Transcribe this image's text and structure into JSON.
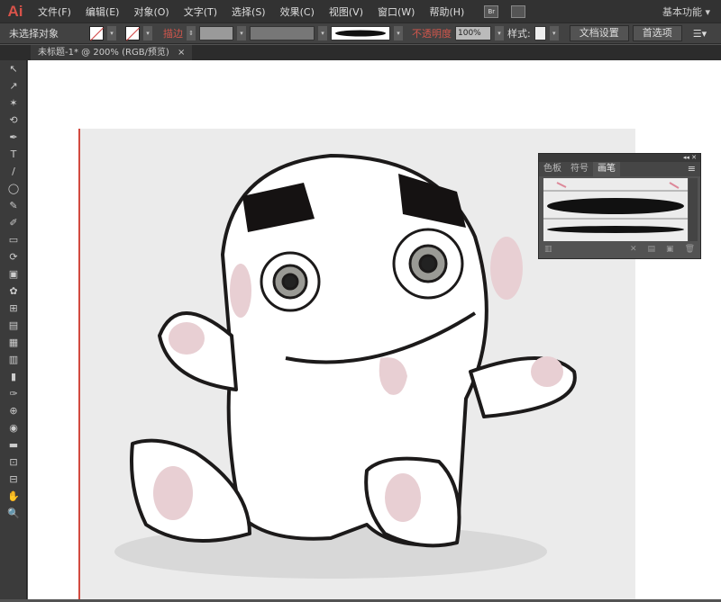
{
  "app": {
    "logo": "Ai",
    "workspace": "基本功能 ▾"
  },
  "menu": [
    "文件(F)",
    "编辑(E)",
    "对象(O)",
    "文字(T)",
    "选择(S)",
    "效果(C)",
    "视图(V)",
    "窗口(W)",
    "帮助(H)"
  ],
  "bridge_label": "Br",
  "control": {
    "selection": "未选择对象",
    "stroke_label": "描边",
    "opacity_label": "不透明度",
    "opacity_value": "100%",
    "style_label": "样式:",
    "doc_setup": "文档设置",
    "preferences": "首选项"
  },
  "document_tab": {
    "title": "未标题-1* @ 200% (RGB/预览)",
    "close": "×"
  },
  "tools": [
    "↖",
    "↗",
    "✶",
    "⟲",
    "✒",
    "T",
    "/",
    "◯",
    "✎",
    "✐",
    "▭",
    "⟳",
    "▣",
    "✿",
    "⊞",
    "▤",
    "▦",
    "▥",
    "▮",
    "✑",
    "⊕",
    "◉",
    "▬",
    "⊡",
    "⊟",
    "✋",
    "🔍"
  ],
  "panel": {
    "controls": "◂◂ ✕",
    "tabs": [
      "色板",
      "符号",
      "画笔"
    ],
    "active_tab": "画笔",
    "menu": "≡"
  },
  "colors": {
    "accent": "#d24a40",
    "ui_dark": "#323232"
  }
}
